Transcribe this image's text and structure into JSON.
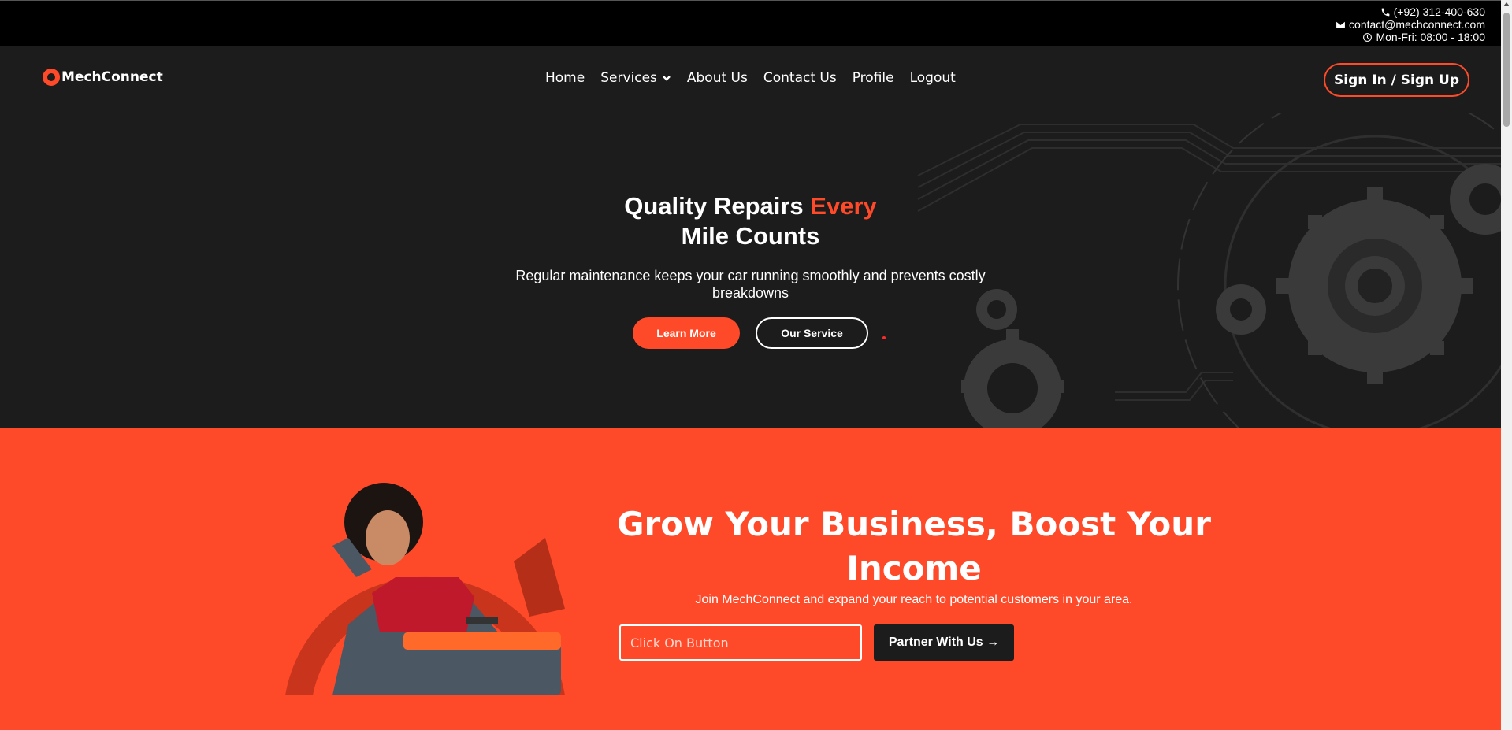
{
  "topbar": {
    "phone": "(+92) 312-400-630",
    "email": "contact@mechconnect.com",
    "hours": "Mon-Fri: 08:00 - 18:00"
  },
  "header": {
    "brand": "MechConnect",
    "nav": {
      "home": "Home",
      "services": "Services",
      "about": "About Us",
      "contact": "Contact Us",
      "profile": "Profile",
      "logout": "Logout"
    },
    "signin_label": "Sign In / Sign Up"
  },
  "hero": {
    "title_part1": "Quality Repairs ",
    "title_accent": "Every",
    "title_part2": "Mile Counts",
    "subtitle": "Regular maintenance keeps your car running smoothly and prevents costly breakdowns",
    "learn_more": "Learn More",
    "our_service": "Our Service"
  },
  "partner": {
    "title": "Grow Your Business, Boost Your Income",
    "subtitle": "Join MechConnect and expand your reach to potential customers in your area.",
    "input_placeholder": "Click On Button",
    "button_label": "Partner With Us →"
  },
  "colors": {
    "accent": "#ff4a2a",
    "dark": "#1c1c1c",
    "topbar": "#000000"
  },
  "icons": [
    "phone-icon",
    "envelope-icon",
    "clock-icon",
    "chevron-down-icon",
    "logo-icon"
  ]
}
